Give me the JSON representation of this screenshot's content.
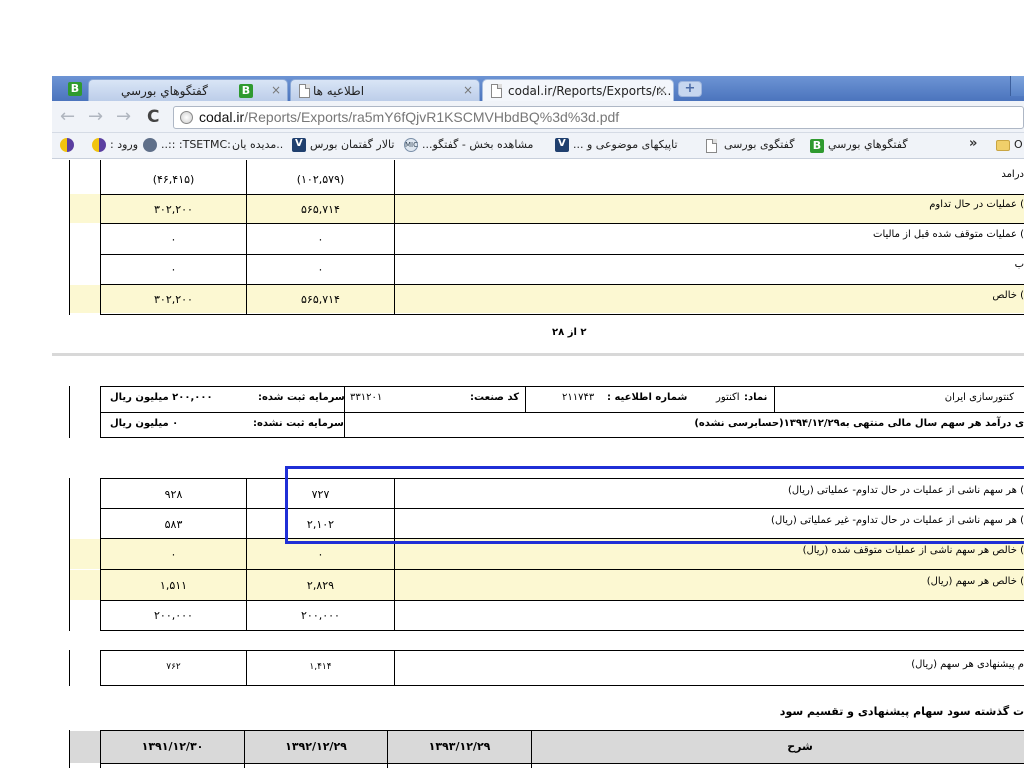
{
  "browser": {
    "tabs": [
      {
        "label": "گفتگوهاي بورسي",
        "favicon": "b-green-icon"
      },
      {
        "label": "اطلاعیه ها",
        "favicon": "document-icon"
      },
      {
        "label": "codal.ir/Reports/Exports/r...",
        "favicon": "document-icon",
        "active": true
      }
    ],
    "tab_close_glyph": "×",
    "url": {
      "host": "codal.ir",
      "path": "/Reports/Exports/ra5mY6fQjvR1KSCMVHbdBQ%3d%3d.pdf"
    },
    "bookmarks": [
      {
        "label": "ورود :",
        "icon": "circle-logo-icon"
      },
      {
        "label": ":TSETMC: ::..",
        "icon": "gear-circle-icon"
      },
      {
        "label": "..مدیده یان",
        "icon": "v-icon"
      },
      {
        "label": "تالار گفتمان بورس",
        "icon": "v-icon"
      },
      {
        "label": "مشاهده بخش - گفتگو...",
        "icon": "mic-icon"
      },
      {
        "label": "تاپیکهای موضوعی و ...",
        "icon": "v-icon"
      },
      {
        "label": "گفتگوی بورسی",
        "icon": "document-icon"
      },
      {
        "label": "گفتگوهاي بورسي",
        "icon": "b-green-icon"
      }
    ],
    "bookmarks_overflow": "»",
    "bookmarks_folder_label": "O"
  },
  "pdf": {
    "page1_rows": [
      {
        "label": "درامد",
        "col1": "(۱۰۲,۵۷۹)",
        "col2": "(۴۶,۴۱۵)",
        "shaded": false
      },
      {
        "label": ") عملیات در حال تداوم",
        "col1": "۵۶۵,۷۱۴",
        "col2": "۳۰۲,۲۰۰",
        "shaded": true
      },
      {
        "label": ") عملیات متوقف شده قبل از مالیات",
        "col1": "۰",
        "col2": "۰",
        "shaded": false
      },
      {
        "label": "ب",
        "col1": "۰",
        "col2": "۰",
        "shaded": false
      },
      {
        "label": ") خالص",
        "col1": "۵۶۵,۷۱۴",
        "col2": "۳۰۲,۲۰۰",
        "shaded": true
      }
    ],
    "page_number": "۲ از ۲۸",
    "header": {
      "company": "کنتورسازی ایران",
      "symbol_label": "نماد:",
      "symbol_value": "اکنتور",
      "notice_label": "شماره اطلاعیه :",
      "notice_value": "۲۱۱۷۴۳",
      "industry_label": "کد صنعت:",
      "industry_value": "۳۳۱۲۰۱",
      "registered_label": "سرمایه ثبت شده:",
      "registered_value": "۲۰۰,۰۰۰ میلیون ریال",
      "unregistered_label": "سرمایه ثبت نشده:",
      "unregistered_value": "۰ میلیون ریال",
      "subtitle": "ی درآمد هر سهم سال مالی منتهی به۱۳۹۴/۱۲/۲۹(حسابرسی نشده)"
    },
    "eps_rows": [
      {
        "label": ") هر سهم ناشی از عملیات در حال تداوم- عملیاتی (ریال)",
        "col1": "۷۲۷",
        "col2": "۹۲۸",
        "shaded": false
      },
      {
        "label": ") هر سهم ناشی از عملیات در حال تداوم- غیر عملیاتی (ریال)",
        "col1": "۲,۱۰۲",
        "col2": "۵۸۳",
        "shaded": false
      },
      {
        "label": ") خالص هر سهم ناشی از عملیات متوقف شده (ریال)",
        "col1": "۰",
        "col2": "۰",
        "shaded": true
      },
      {
        "label": ") خالص هر سهم (ریال)",
        "col1": "۲,۸۲۹",
        "col2": "۱,۵۱۱",
        "shaded": true
      },
      {
        "label": "",
        "col1": "۲۰۰,۰۰۰",
        "col2": "۲۰۰,۰۰۰",
        "shaded": false
      }
    ],
    "dps_row": {
      "label": "م پیشنهادی هر سهم (ریال)",
      "col1": "۱,۴۱۴",
      "col2": "۷۶۲"
    },
    "history_title": "ت گذشته سود سهام پیشنهادی و تقسیم سود",
    "history_header": {
      "desc": "شرح",
      "y1393": "۱۳۹۳/۱۲/۲۹",
      "y1392": "۱۳۹۲/۱۲/۲۹",
      "y1391": "۱۳۹۱/۱۲/۳۰"
    }
  },
  "colors": {
    "highlight": "#1f2fd6",
    "shaded_row": "#fcf8d2",
    "tabstrip": "#5a82c6"
  }
}
